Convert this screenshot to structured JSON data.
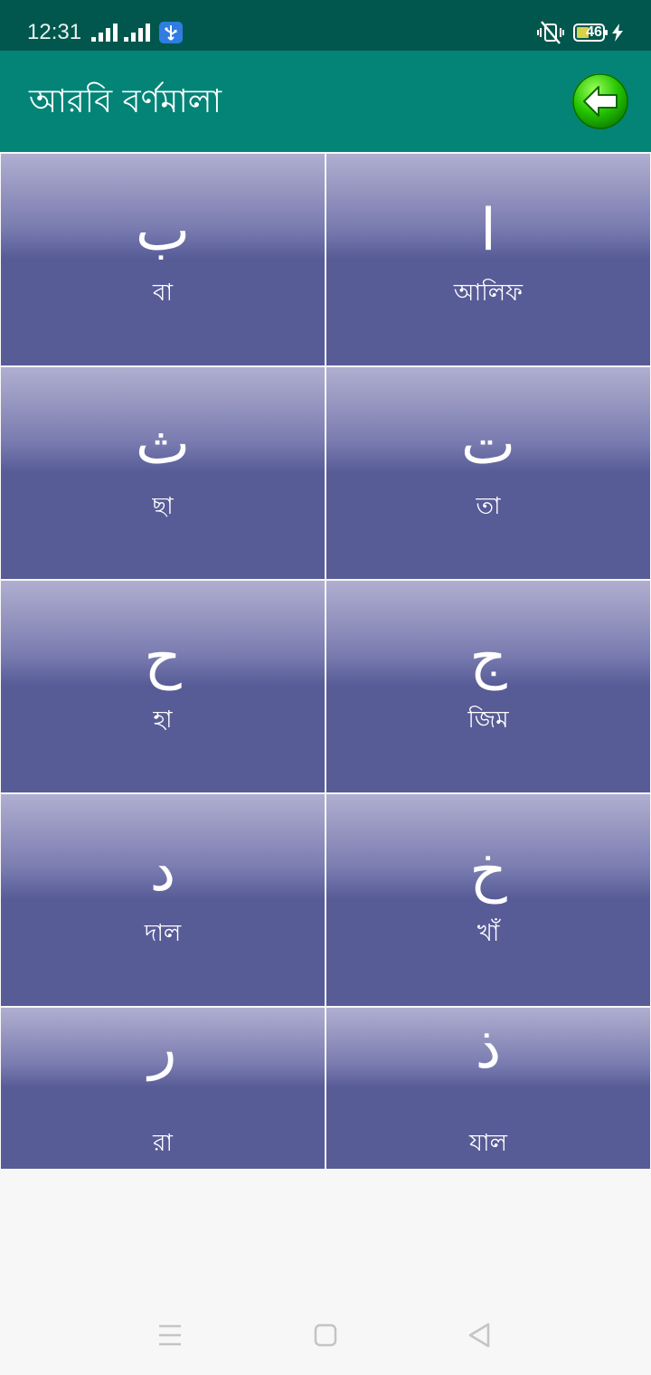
{
  "status_bar": {
    "time": "12:31",
    "battery_level": "46",
    "icons": [
      "signal-icon",
      "signal-icon",
      "usb-icon",
      "mute-vibrate-icon",
      "battery-icon",
      "charging-icon"
    ]
  },
  "app_bar": {
    "title": "আরবি বর্ণমালা",
    "back_icon": "back-arrow-icon",
    "back_color": "#22c400"
  },
  "letters": [
    {
      "arabic": "ب",
      "bengali": "বা"
    },
    {
      "arabic": "ا",
      "bengali": "আলিফ"
    },
    {
      "arabic": "ث",
      "bengali": "ছা"
    },
    {
      "arabic": "ت",
      "bengali": "তা"
    },
    {
      "arabic": "ح",
      "bengali": "হা"
    },
    {
      "arabic": "ج",
      "bengali": "জিম"
    },
    {
      "arabic": "د",
      "bengali": "দাল"
    },
    {
      "arabic": "خ",
      "bengali": "খাঁ"
    },
    {
      "arabic": "ر",
      "bengali": "রা"
    },
    {
      "arabic": "ذ",
      "bengali": "যাল"
    }
  ],
  "colors": {
    "status_bar": "#01574d",
    "app_bar": "#038477",
    "tile": "#575b96",
    "background": "#f7f7f7"
  },
  "nav_bar": {
    "icons": [
      "menu-icon",
      "home-icon",
      "back-icon"
    ]
  }
}
